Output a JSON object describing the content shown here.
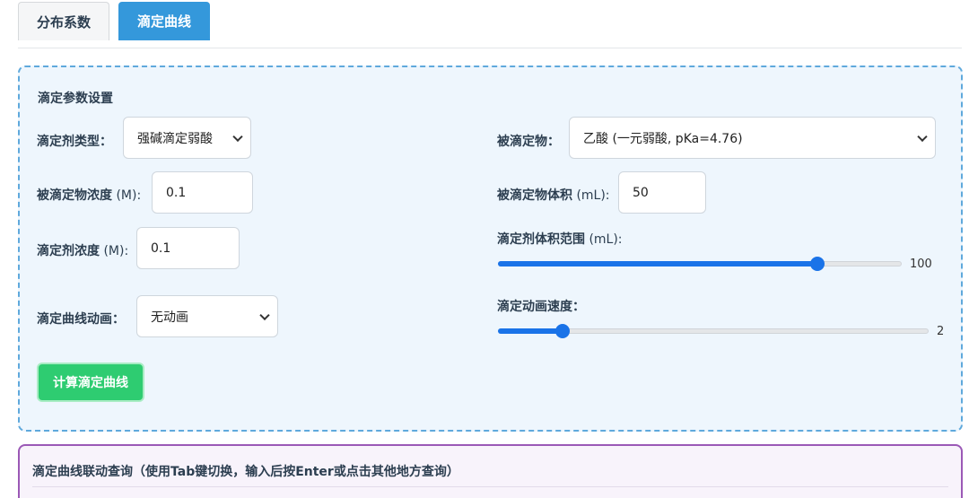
{
  "tabs": [
    {
      "label": "分布系数"
    },
    {
      "label": "滴定曲线"
    }
  ],
  "settings": {
    "title": "滴定参数设置",
    "titrant_type": {
      "label": "滴定剂类型：",
      "value": "强碱滴定弱酸"
    },
    "analyte": {
      "label": "被滴定物：",
      "value": "乙酸 (一元弱酸, pKa=4.76)"
    },
    "analyte_conc": {
      "label": "被滴定物浓度",
      "unit": " (M):",
      "value": "0.1"
    },
    "analyte_vol": {
      "label": "被滴定物体积",
      "unit": " (mL):",
      "value": "50"
    },
    "titrant_conc": {
      "label": "滴定剂浓度",
      "unit": " (M):",
      "value": "0.1"
    },
    "titrant_range": {
      "label": "滴定剂体积范围",
      "unit": " (mL):",
      "value": "100",
      "fraction": 0.79
    },
    "animation": {
      "label": "滴定曲线动画：",
      "value": "无动画"
    },
    "speed": {
      "label": "滴定动画速度：",
      "value": "2",
      "fraction": 0.15
    },
    "calc_button": "计算滴定曲线"
  },
  "query": {
    "title": "滴定曲线联动查询（使用Tab键切换，输入后按Enter或点击其他地方查询）"
  },
  "colors": {
    "tab_active": "#3498db",
    "panel_border": "#5fa9dc",
    "button": "#2ecc71",
    "slider": "#1a73e8",
    "query_border": "#9b59b6"
  }
}
